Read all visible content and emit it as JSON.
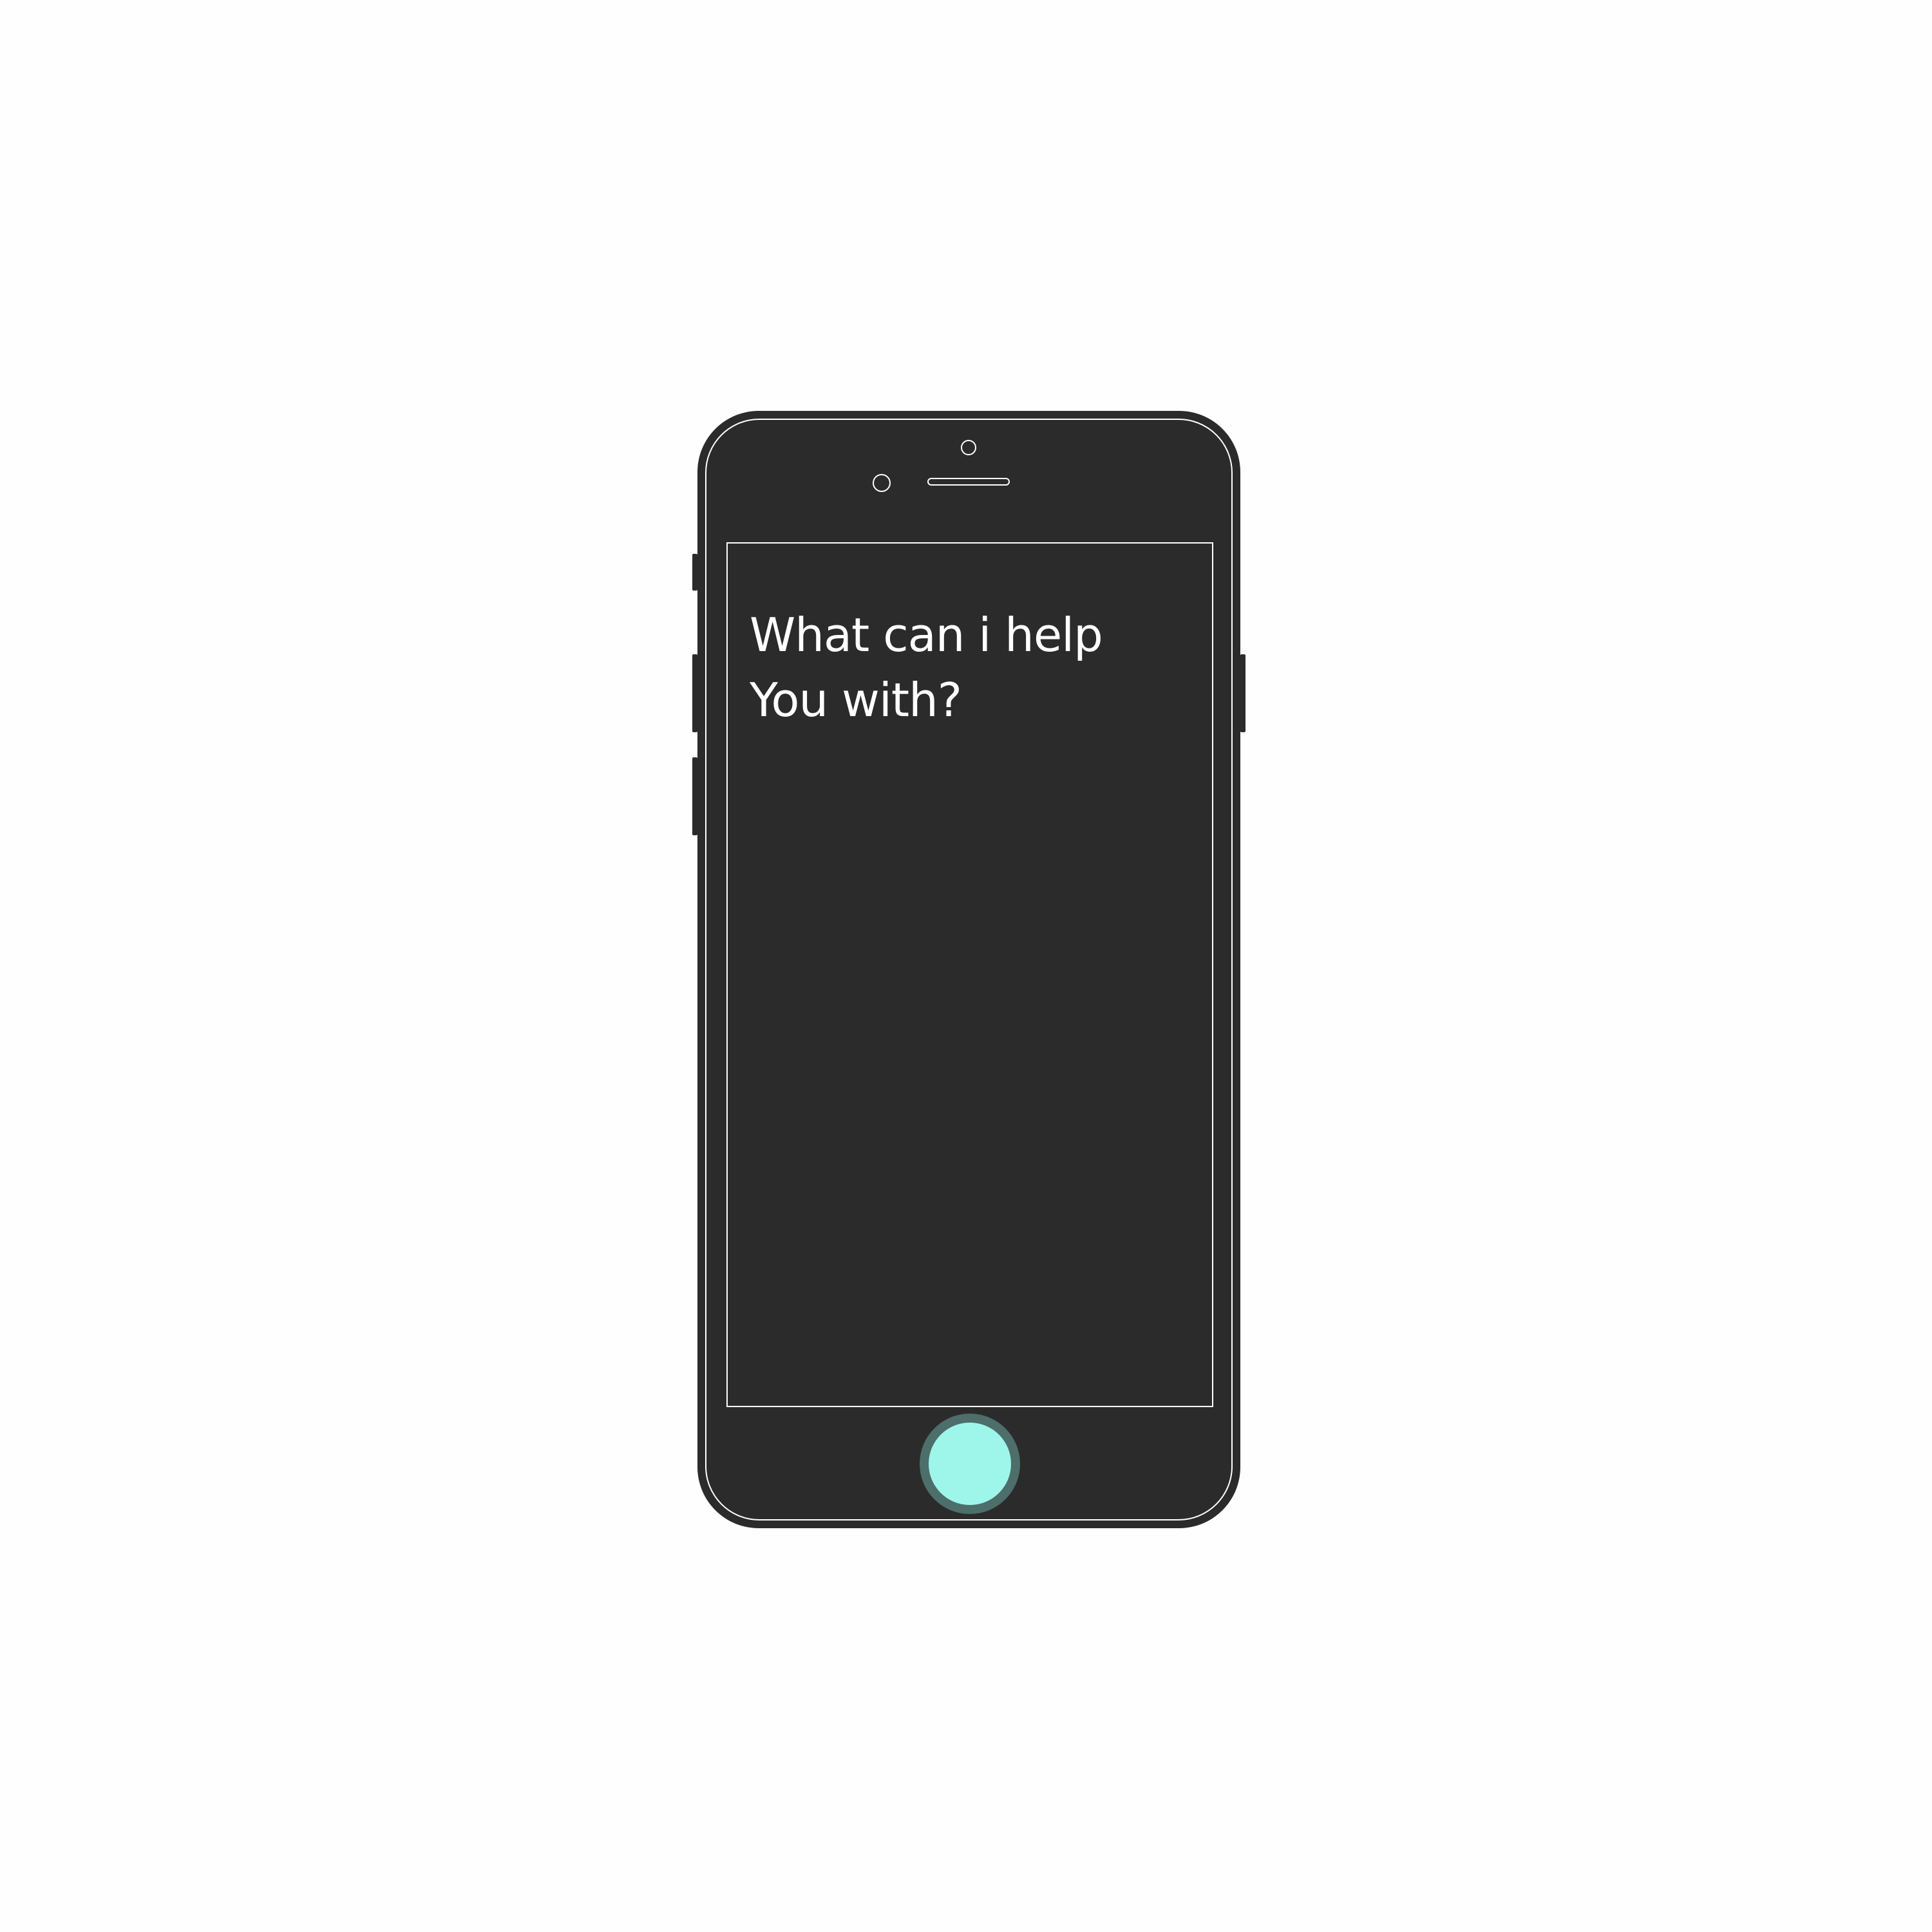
{
  "assistant": {
    "prompt_line_1": "What can i help",
    "prompt_line_2": "You with?"
  },
  "colors": {
    "background": "#fefefe",
    "phone_body": "#2b2b2b",
    "outline": "#ffffff",
    "home_button": "#9ef6ea",
    "home_button_ring": "#4d6e6a"
  },
  "icons": {
    "front_camera": "camera-icon",
    "proximity_sensor": "sensor-icon",
    "speaker": "speaker-grille-icon",
    "home": "home-button-icon"
  }
}
